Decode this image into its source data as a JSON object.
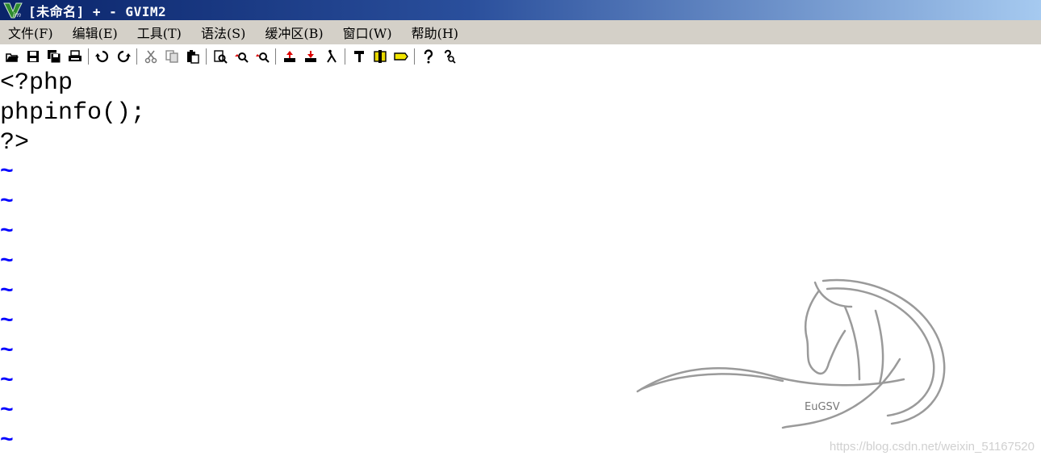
{
  "window": {
    "title": "[未命名] + - GVIM2"
  },
  "menu": [
    {
      "label": "文件(F)",
      "name": "menu-file"
    },
    {
      "label": "编辑(E)",
      "name": "menu-edit"
    },
    {
      "label": "工具(T)",
      "name": "menu-tools"
    },
    {
      "label": "语法(S)",
      "name": "menu-syntax"
    },
    {
      "label": "缓冲区(B)",
      "name": "menu-buffers"
    },
    {
      "label": "窗口(W)",
      "name": "menu-window"
    },
    {
      "label": "帮助(H)",
      "name": "menu-help"
    }
  ],
  "toolbar_icons": [
    "open-icon",
    "save-icon",
    "save-all-icon",
    "print-icon",
    "undo-icon",
    "redo-icon",
    "cut-icon",
    "copy-icon",
    "paste-icon",
    "find-icon",
    "find-next-icon",
    "find-prev-icon",
    "load-session-icon",
    "save-session-icon",
    "run-script-icon",
    "make-icon",
    "shell-icon",
    "tags-icon",
    "help-icon",
    "find-help-icon"
  ],
  "editor": {
    "lines": [
      "<?php",
      "phpinfo();",
      "?>"
    ],
    "tilde": "~"
  },
  "logo_text": "EuGSV",
  "watermark": "https://blog.csdn.net/weixin_51167520"
}
